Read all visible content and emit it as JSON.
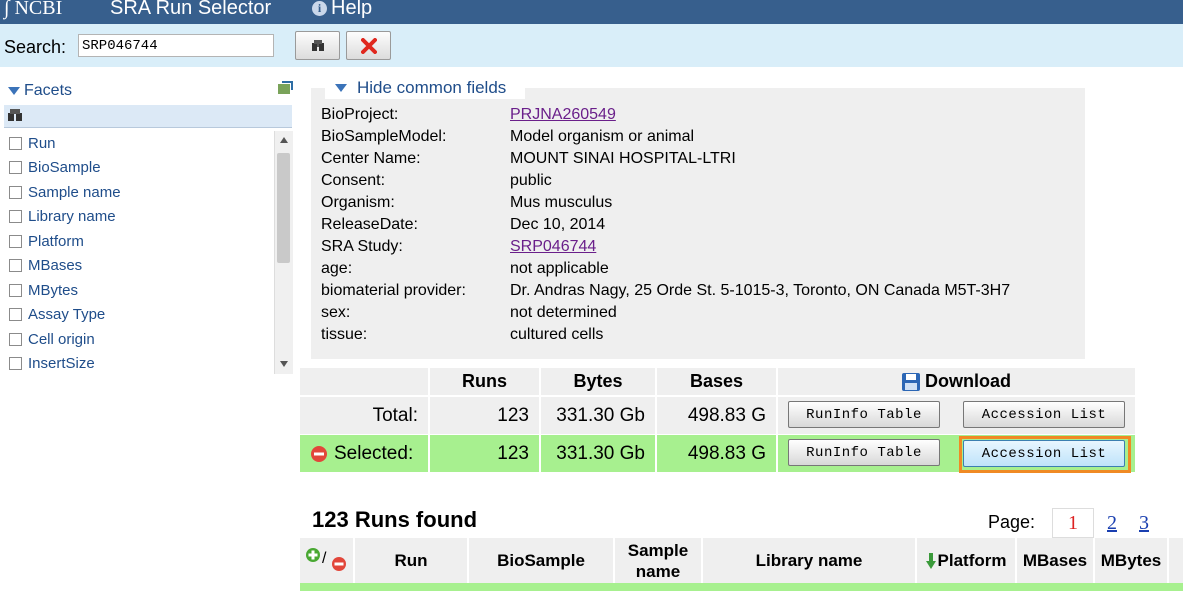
{
  "topbar": {
    "logo": "NCBI",
    "title": "SRA Run Selector",
    "help": "Help"
  },
  "search": {
    "label": "Search:",
    "value": "SRP046744"
  },
  "facets": {
    "title": "Facets",
    "items": [
      "Run",
      "BioSample",
      "Sample name",
      "Library name",
      "Platform",
      "MBases",
      "MBytes",
      "Assay Type",
      "Cell origin",
      "InsertSize"
    ]
  },
  "common_fields": {
    "toggle_label": "Hide common fields",
    "fields": [
      {
        "key": "BioProject:",
        "value": "PRJNA260549"
      },
      {
        "key": "BioSampleModel:",
        "value": "Model organism or animal"
      },
      {
        "key": "Center Name:",
        "value": "MOUNT SINAI HOSPITAL-LTRI"
      },
      {
        "key": "Consent:",
        "value": "public"
      },
      {
        "key": "Organism:",
        "value": "Mus musculus"
      },
      {
        "key": "ReleaseDate:",
        "value": "Dec 10, 2014"
      },
      {
        "key": "SRA Study:",
        "value": "SRP046744"
      },
      {
        "key": "age:",
        "value": "not applicable"
      },
      {
        "key": "biomaterial provider:",
        "value": "Dr. Andras Nagy, 25 Orde St. 5-1015-3, Toronto, ON Canada M5T-3H7"
      },
      {
        "key": "sex:",
        "value": "not determined"
      },
      {
        "key": "tissue:",
        "value": "cultured cells"
      }
    ]
  },
  "summary": {
    "headers": {
      "runs": "Runs",
      "bytes": "Bytes",
      "bases": "Bases",
      "download": "Download"
    },
    "total": {
      "label": "Total:",
      "runs": "123",
      "bytes": "331.30 Gb",
      "bases": "498.83 G"
    },
    "selected": {
      "label": "Selected:",
      "runs": "123",
      "bytes": "331.30 Gb",
      "bases": "498.83 G"
    },
    "runinfo_label": "RunInfo Table",
    "accession_label": "Accession List"
  },
  "results": {
    "found": "123 Runs found",
    "page_label": "Page:",
    "pages": [
      "1",
      "2",
      "3"
    ],
    "columns": {
      "run": "Run",
      "biosample": "BioSample",
      "sample_name": "Sample name",
      "library_name": "Library name",
      "platform": "Platform",
      "mbases": "MBases",
      "mbytes": "MBytes"
    }
  },
  "colors": {
    "topbar": "#375f8d",
    "searchbar": "#d9eef9",
    "selected_row": "#a7f08f",
    "highlight": "#f08a24",
    "link_visited": "#6a1f8a"
  }
}
